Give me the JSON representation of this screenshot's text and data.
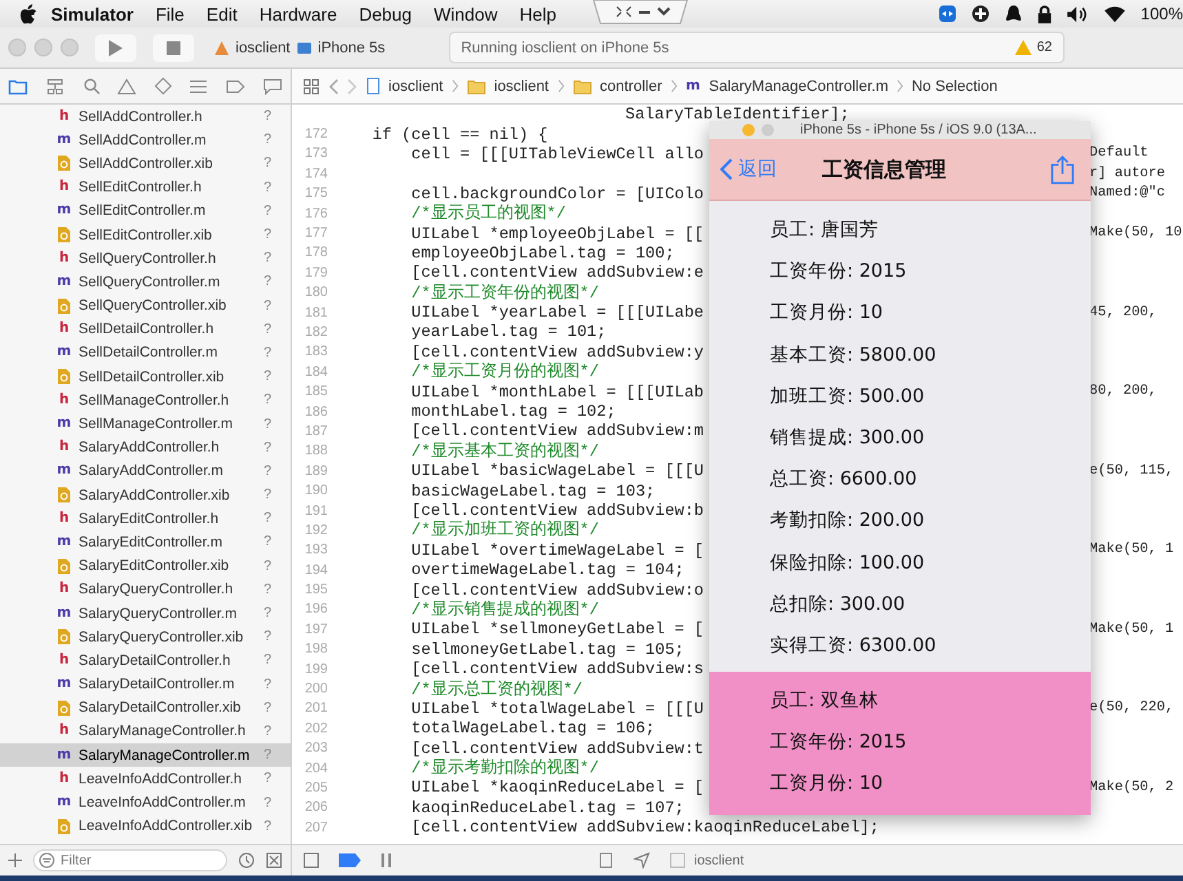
{
  "menu_bar": {
    "app_name": "Simulator",
    "menus": [
      "File",
      "Edit",
      "Hardware",
      "Debug",
      "Window",
      "Help"
    ],
    "battery": "100%"
  },
  "toolbar": {
    "scheme": "iosclient",
    "device": "iPhone 5s",
    "status": "Running iosclient on iPhone 5s",
    "warnings": "62"
  },
  "jump_bar": {
    "path": [
      {
        "label": "iosclient",
        "kind": "project"
      },
      {
        "label": "iosclient",
        "kind": "folder"
      },
      {
        "label": "controller",
        "kind": "folder"
      },
      {
        "label": "SalaryManageController.m",
        "kind": "source",
        "glyph": "m"
      }
    ],
    "selection": "No Selection"
  },
  "navigator": {
    "files": [
      {
        "name": "SellAddController.h",
        "kind": "header",
        "glyph": "h",
        "status": "?",
        "selected": false
      },
      {
        "name": "SellAddController.m",
        "kind": "source",
        "glyph": "m",
        "status": "?",
        "selected": false
      },
      {
        "name": "SellAddController.xib",
        "kind": "xib",
        "status": "?",
        "selected": false
      },
      {
        "name": "SellEditController.h",
        "kind": "header",
        "glyph": "h",
        "status": "?",
        "selected": false
      },
      {
        "name": "SellEditController.m",
        "kind": "source",
        "glyph": "m",
        "status": "?",
        "selected": false
      },
      {
        "name": "SellEditController.xib",
        "kind": "xib",
        "status": "?",
        "selected": false
      },
      {
        "name": "SellQueryController.h",
        "kind": "header",
        "glyph": "h",
        "status": "?",
        "selected": false
      },
      {
        "name": "SellQueryController.m",
        "kind": "source",
        "glyph": "m",
        "status": "?",
        "selected": false
      },
      {
        "name": "SellQueryController.xib",
        "kind": "xib",
        "status": "?",
        "selected": false
      },
      {
        "name": "SellDetailController.h",
        "kind": "header",
        "glyph": "h",
        "status": "?",
        "selected": false
      },
      {
        "name": "SellDetailController.m",
        "kind": "source",
        "glyph": "m",
        "status": "?",
        "selected": false
      },
      {
        "name": "SellDetailController.xib",
        "kind": "xib",
        "status": "?",
        "selected": false
      },
      {
        "name": "SellManageController.h",
        "kind": "header",
        "glyph": "h",
        "status": "?",
        "selected": false
      },
      {
        "name": "SellManageController.m",
        "kind": "source",
        "glyph": "m",
        "status": "?",
        "selected": false
      },
      {
        "name": "SalaryAddController.h",
        "kind": "header",
        "glyph": "h",
        "status": "?",
        "selected": false
      },
      {
        "name": "SalaryAddController.m",
        "kind": "source",
        "glyph": "m",
        "status": "?",
        "selected": false
      },
      {
        "name": "SalaryAddController.xib",
        "kind": "xib",
        "status": "?",
        "selected": false
      },
      {
        "name": "SalaryEditController.h",
        "kind": "header",
        "glyph": "h",
        "status": "?",
        "selected": false
      },
      {
        "name": "SalaryEditController.m",
        "kind": "source",
        "glyph": "m",
        "status": "?",
        "selected": false
      },
      {
        "name": "SalaryEditController.xib",
        "kind": "xib",
        "status": "?",
        "selected": false
      },
      {
        "name": "SalaryQueryController.h",
        "kind": "header",
        "glyph": "h",
        "status": "?",
        "selected": false
      },
      {
        "name": "SalaryQueryController.m",
        "kind": "source",
        "glyph": "m",
        "status": "?",
        "selected": false
      },
      {
        "name": "SalaryQueryController.xib",
        "kind": "xib",
        "status": "?",
        "selected": false
      },
      {
        "name": "SalaryDetailController.h",
        "kind": "header",
        "glyph": "h",
        "status": "?",
        "selected": false
      },
      {
        "name": "SalaryDetailController.m",
        "kind": "source",
        "glyph": "m",
        "status": "?",
        "selected": false
      },
      {
        "name": "SalaryDetailController.xib",
        "kind": "xib",
        "status": "?",
        "selected": false
      },
      {
        "name": "SalaryManageController.h",
        "kind": "header",
        "glyph": "h",
        "status": "?",
        "selected": false
      },
      {
        "name": "SalaryManageController.m",
        "kind": "source",
        "glyph": "m",
        "status": "?",
        "selected": true
      },
      {
        "name": "LeaveInfoAddController.h",
        "kind": "header",
        "glyph": "h",
        "status": "?",
        "selected": false
      },
      {
        "name": "LeaveInfoAddController.m",
        "kind": "source",
        "glyph": "m",
        "status": "?",
        "selected": false
      },
      {
        "name": "LeaveInfoAddController.xib",
        "kind": "xib",
        "status": "?",
        "selected": false
      }
    ],
    "filter": {
      "placeholder": "Filter"
    }
  },
  "editor": {
    "lines": [
      {
        "kind": "continuation",
        "text": "SalaryTableIdentifier];"
      },
      {
        "number": "172",
        "kind": "code",
        "text": "    if (cell == nil) {"
      },
      {
        "number": "173",
        "kind": "code",
        "text": "        cell = [[[UITableViewCell allo",
        "right": "Default"
      },
      {
        "number": "174",
        "right": "r] autore"
      },
      {
        "number": "175",
        "kind": "code",
        "text": "        cell.backgroundColor = [UIColo",
        "right": "Named:@\"c"
      },
      {
        "number": "176",
        "kind": "comment",
        "text": "        /*显示员工的视图*/"
      },
      {
        "number": "177",
        "kind": "code",
        "text": "        UILabel *employeeObjLabel = [[",
        "right": "Make(50, 10"
      },
      {
        "number": "178",
        "kind": "code",
        "text": "        employeeObjLabel.tag = 100;"
      },
      {
        "number": "179",
        "kind": "code",
        "text": "        [cell.contentView addSubview:e"
      },
      {
        "number": "180",
        "kind": "comment",
        "text": "        /*显示工资年份的视图*/"
      },
      {
        "number": "181",
        "kind": "code",
        "text": "        UILabel *yearLabel = [[[UILabe",
        "right": "45, 200,"
      },
      {
        "number": "182",
        "kind": "code",
        "text": "        yearLabel.tag = 101;"
      },
      {
        "number": "183",
        "kind": "code",
        "text": "        [cell.contentView addSubview:y"
      },
      {
        "number": "184",
        "kind": "comment",
        "text": "        /*显示工资月份的视图*/"
      },
      {
        "number": "185",
        "kind": "code",
        "text": "        UILabel *monthLabel = [[[UILab",
        "right": "80, 200,"
      },
      {
        "number": "186",
        "kind": "code",
        "text": "        monthLabel.tag = 102;"
      },
      {
        "number": "187",
        "kind": "code",
        "text": "        [cell.contentView addSubview:m"
      },
      {
        "number": "188",
        "kind": "comment",
        "text": "        /*显示基本工资的视图*/"
      },
      {
        "number": "189",
        "kind": "code",
        "text": "        UILabel *basicWageLabel = [[[U",
        "right": "e(50, 115,"
      },
      {
        "number": "190",
        "kind": "code",
        "text": "        basicWageLabel.tag = 103;"
      },
      {
        "number": "191",
        "kind": "code",
        "text": "        [cell.contentView addSubview:b"
      },
      {
        "number": "192",
        "kind": "comment",
        "text": "        /*显示加班工资的视图*/"
      },
      {
        "number": "193",
        "kind": "code",
        "text": "        UILabel *overtimeWageLabel = [",
        "right": "Make(50, 1"
      },
      {
        "number": "194",
        "kind": "code",
        "text": "        overtimeWageLabel.tag = 104;"
      },
      {
        "number": "195",
        "kind": "code",
        "text": "        [cell.contentView addSubview:o"
      },
      {
        "number": "196",
        "kind": "comment",
        "text": "        /*显示销售提成的视图*/"
      },
      {
        "number": "197",
        "kind": "code",
        "text": "        UILabel *sellmoneyGetLabel = [",
        "right": "Make(50, 1"
      },
      {
        "number": "198",
        "kind": "code",
        "text": "        sellmoneyGetLabel.tag = 105;"
      },
      {
        "number": "199",
        "kind": "code",
        "text": "        [cell.contentView addSubview:s"
      },
      {
        "number": "200",
        "kind": "comment",
        "text": "        /*显示总工资的视图*/"
      },
      {
        "number": "201",
        "kind": "code",
        "text": "        UILabel *totalWageLabel = [[[U",
        "right": "e(50, 220,"
      },
      {
        "number": "202",
        "kind": "code",
        "text": "        totalWageLabel.tag = 106;"
      },
      {
        "number": "203",
        "kind": "code",
        "text": "        [cell.contentView addSubview:t"
      },
      {
        "number": "204",
        "kind": "comment",
        "text": "        /*显示考勤扣除的视图*/"
      },
      {
        "number": "205",
        "kind": "code",
        "text": "        UILabel *kaoqinReduceLabel = [",
        "right": "Make(50, 2"
      },
      {
        "number": "206",
        "kind": "code",
        "text": "        kaoqinReduceLabel.tag = 107;"
      },
      {
        "number": "207",
        "kind": "code",
        "text": "        [cell.contentView addSubview:kaoqinReduceLabel];"
      }
    ],
    "debug_target": "iosclient"
  },
  "simulator": {
    "title": "iPhone 5s - iPhone 5s / iOS 9.0 (13A...",
    "back": "返回",
    "screen_title": "工资信息管理",
    "cells": [
      {
        "color": "#ececf0",
        "fields": [
          "员工: 唐国芳",
          "工资年份: 2015",
          "工资月份: 10",
          "基本工资: 5800.00",
          "加班工资: 500.00",
          "销售提成: 300.00",
          "总工资: 6600.00",
          "考勤扣除: 200.00",
          "保险扣除: 100.00",
          "总扣除: 300.00",
          "实得工资: 6300.00"
        ]
      },
      {
        "color": "#f190c6",
        "fields": [
          "员工: 双鱼林",
          "工资年份: 2015",
          "工资月份: 10"
        ]
      }
    ]
  }
}
